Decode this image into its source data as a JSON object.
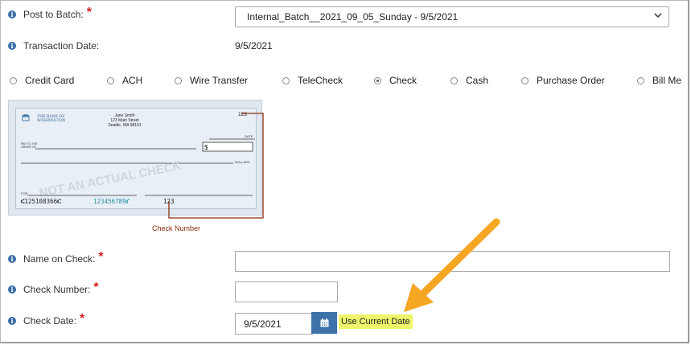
{
  "form": {
    "post_to_batch": {
      "label": "Post to Batch:",
      "required": "*",
      "value": "Internal_Batch__2021_09_05_Sunday - 9/5/2021"
    },
    "transaction_date": {
      "label": "Transaction Date:",
      "value": "9/5/2021"
    },
    "payment_methods": [
      {
        "label": "Credit Card",
        "selected": false
      },
      {
        "label": "ACH",
        "selected": false
      },
      {
        "label": "Wire Transfer",
        "selected": false
      },
      {
        "label": "TeleCheck",
        "selected": false
      },
      {
        "label": "Check",
        "selected": true
      },
      {
        "label": "Cash",
        "selected": false
      },
      {
        "label": "Purchase Order",
        "selected": false
      },
      {
        "label": "Bill Me",
        "selected": false
      }
    ],
    "name_on_check": {
      "label": "Name on Check:",
      "required": "*",
      "value": ""
    },
    "check_number": {
      "label": "Check Number:",
      "required": "*",
      "value": ""
    },
    "check_date": {
      "label": "Check Date:",
      "required": "*",
      "value": "9/5/2021",
      "use_current": "Use Current Date"
    }
  },
  "check_image": {
    "bank_name_line1": "THE BANK OF",
    "bank_name_line2": "WASHINGTON",
    "payer_name": "Jane Smith",
    "payer_address1": "123 Main Street",
    "payer_address2": "Seattle, WA 98101",
    "check_no": "123",
    "date_label": "DATE",
    "pay_to_label_1": "PAY TO THE",
    "pay_to_label_2": "ORDER OF",
    "dollar_sign": "$",
    "dollars_label": "DOLLARS",
    "watermark": "NOT AN ACTUAL CHECK",
    "for_label": "FOR",
    "micr_routing": "⑆125108366⑆",
    "micr_account": "123456789⑈",
    "micr_check": "123",
    "callout": "Check Number"
  },
  "annotation_arrow_color": "#f5a623",
  "accent_color": "#3b72a9"
}
